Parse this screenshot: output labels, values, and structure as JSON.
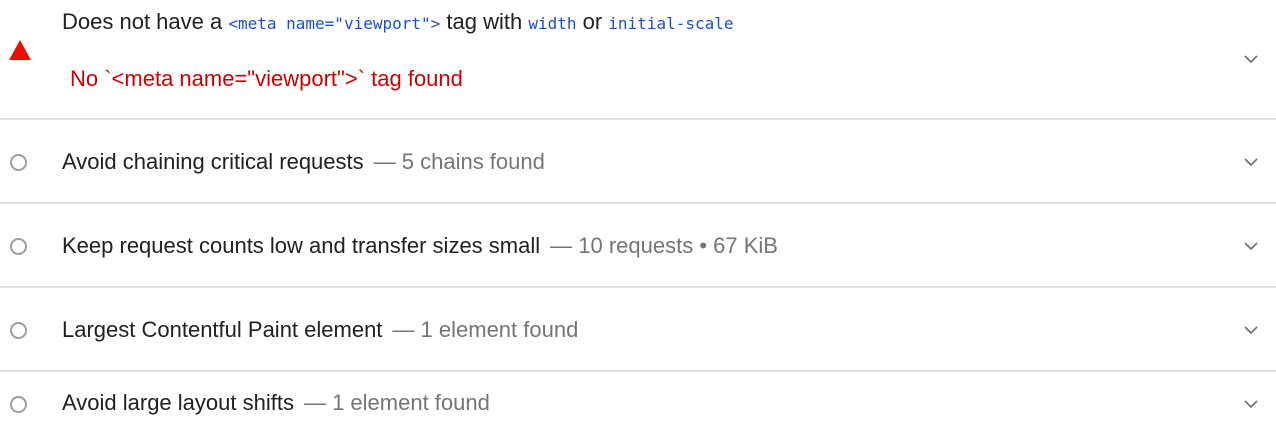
{
  "audits": [
    {
      "status": "fail",
      "status_icon": "warning-triangle-icon",
      "title_parts": {
        "pre": "Does not have a ",
        "code1": "<meta name=\"viewport\">",
        "mid1": " tag with ",
        "code2": "width",
        "mid2": " or ",
        "code3": "initial-scale"
      },
      "error_message": "No `<meta name=\"viewport\">` tag found",
      "expand_icon": "chevron-down-icon"
    },
    {
      "status": "info",
      "status_icon": "circle-icon",
      "title": "Avoid chaining critical requests",
      "display_value": "— 5 chains found",
      "expand_icon": "chevron-down-icon"
    },
    {
      "status": "info",
      "status_icon": "circle-icon",
      "title": "Keep request counts low and transfer sizes small",
      "display_value": "— 10 requests • 67 KiB",
      "expand_icon": "chevron-down-icon"
    },
    {
      "status": "info",
      "status_icon": "circle-icon",
      "title": "Largest Contentful Paint element",
      "display_value": "— 1 element found",
      "expand_icon": "chevron-down-icon"
    },
    {
      "status": "info",
      "status_icon": "circle-icon",
      "title": "Avoid large layout shifts",
      "display_value": "— 1 element found",
      "expand_icon": "chevron-down-icon"
    }
  ],
  "colors": {
    "fail": "#eb0f00",
    "error_text": "#cc0000",
    "code_text": "#1a4fd0",
    "muted_text": "#757575",
    "neutral_icon": "#9e9e9e",
    "divider": "#e0e0e0"
  }
}
